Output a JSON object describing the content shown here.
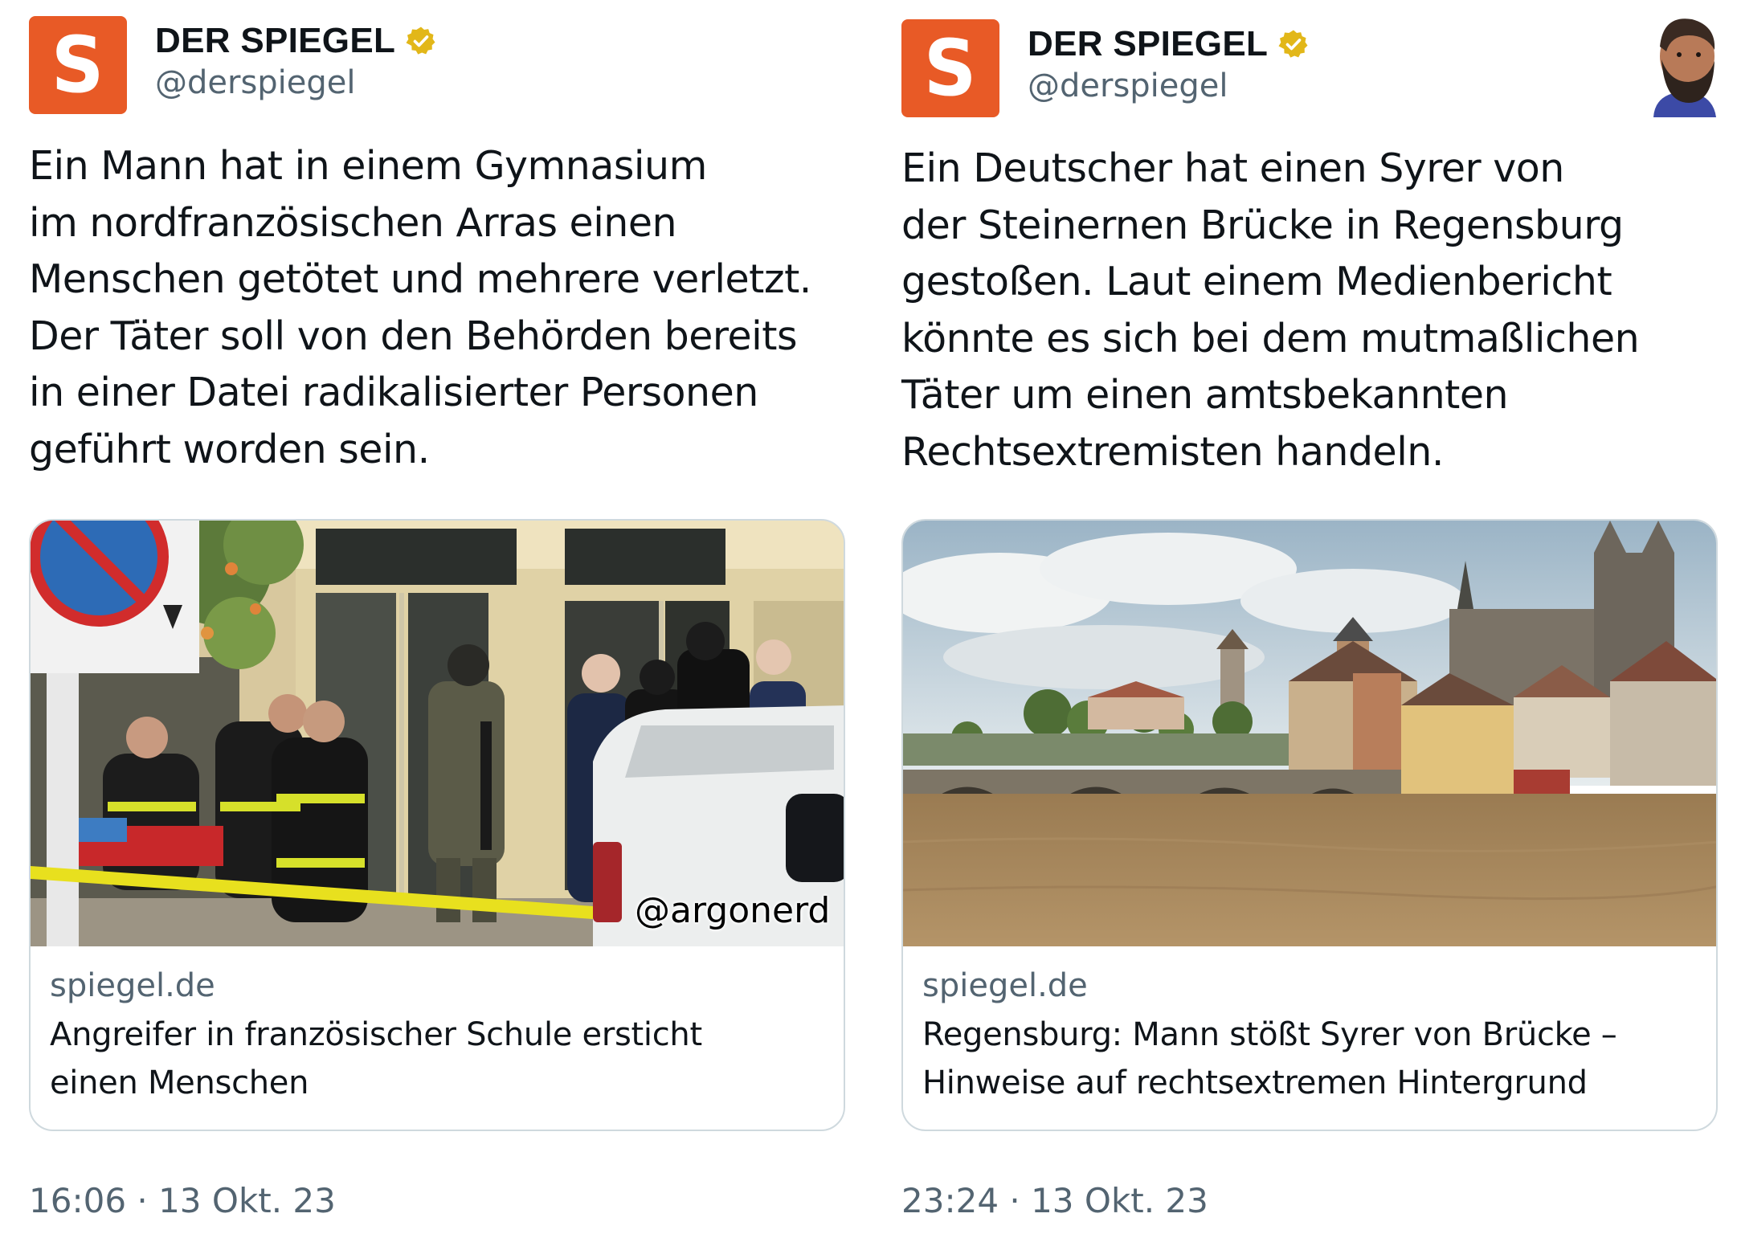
{
  "tweets": [
    {
      "author": {
        "display_name": "DER SPIEGEL",
        "handle": "@derspiegel",
        "logo_letter": "S",
        "brand_color": "#e85a26",
        "verified_badge": "gold-verified-icon"
      },
      "text_lines": [
        "Ein Mann hat in einem Gymnasium",
        "im nordfranzösischen Arras einen",
        "Menschen getötet und mehrere verletzt.",
        "Der Täter soll von den Behörden bereits",
        "in einer Datei radikalisierter Personen",
        "geführt worden sein."
      ],
      "card": {
        "image_watermark": "@argonerd",
        "domain": "spiegel.de",
        "title_lines": [
          "Angreifer in französischer Schule ersticht",
          "einen Menschen"
        ]
      },
      "timestamp": "16:06 · 13 Okt. 23"
    },
    {
      "author": {
        "display_name": "DER SPIEGEL",
        "handle": "@derspiegel",
        "logo_letter": "S",
        "brand_color": "#e85a26",
        "verified_badge": "gold-verified-icon"
      },
      "text_lines": [
        "Ein Deutscher hat einen Syrer von",
        "der Steinernen Brücke in Regensburg",
        "gestoßen. Laut einem Medienbericht",
        "könnte es sich bei dem mutmaßlichen",
        "Täter um einen amtsbekannten",
        "Rechtsextremisten handeln."
      ],
      "card": {
        "domain": "spiegel.de",
        "title_lines": [
          "Regensburg: Mann stößt Syrer von Brücke –",
          "Hinweise auf rechtsextremen Hintergrund"
        ]
      },
      "timestamp": "23:24 · 13 Okt. 23"
    }
  ],
  "avatar": {
    "icon": "bearded-man-avatar-icon"
  }
}
